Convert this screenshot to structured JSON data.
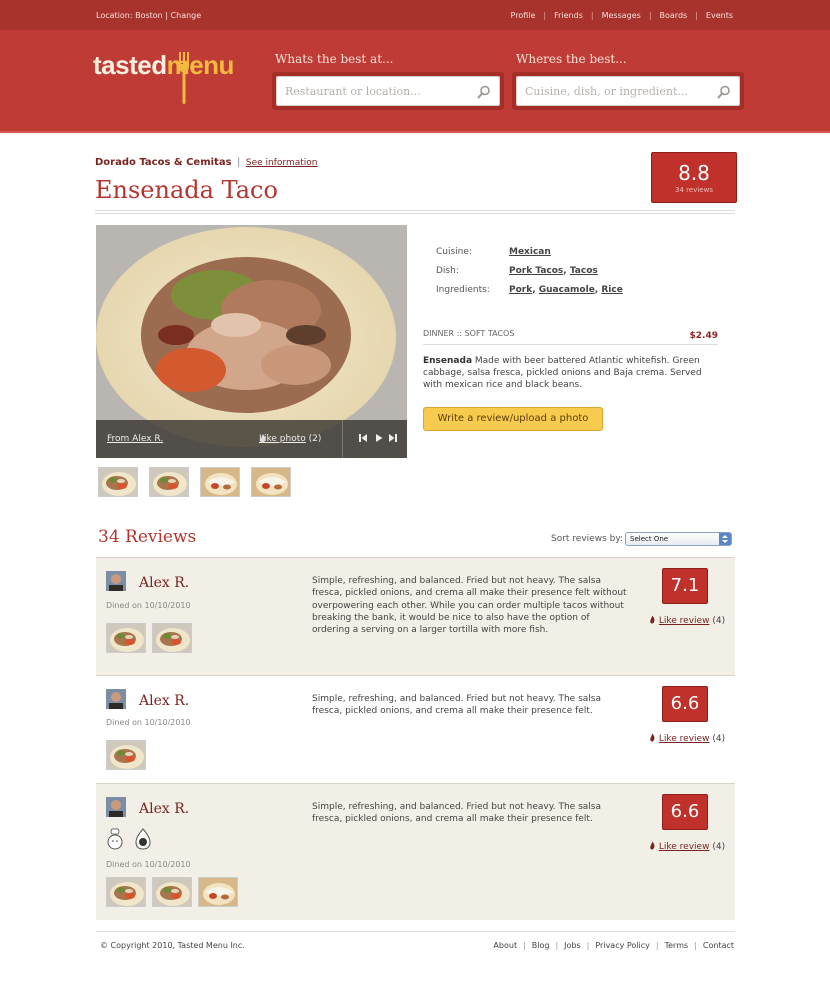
{
  "topbar": {
    "location_label": "Location: Boston",
    "change_label": "Change",
    "nav": [
      "Profile",
      "Friends",
      "Messages",
      "Boards",
      "Events"
    ]
  },
  "header": {
    "logo_main": "tasted",
    "logo_accent": "menu",
    "search_best_label": "Whats the best at...",
    "search_best_placeholder": "Restaurant or location...",
    "search_where_label": "Wheres the best...",
    "search_where_placeholder": "Cuisine, dish, or ingredient..."
  },
  "dish": {
    "restaurant": "Dorado Tacos & Cemitas",
    "see_info": "See information",
    "title": "Ensenada Taco",
    "score": "8.8",
    "review_count_label": "34 reviews"
  },
  "photo": {
    "from": "From Alex R.",
    "like_label": "Like photo",
    "like_count": "(2)"
  },
  "details": {
    "cuisine_label": "Cuisine:",
    "cuisine": "Mexican",
    "dish_label": "Dish:",
    "dish_1": "Pork Tacos",
    "dish_2": "Tacos",
    "ingredients_label": "Ingredients:",
    "ing_1": "Pork",
    "ing_2": "Guacamole",
    "ing_3": "Rice",
    "menu_section": "DINNER :: SOFT TACOS",
    "price": "$2.49",
    "desc_name": "Ensenada",
    "desc_text": " Made with beer battered Atlantic whitefish. Green cabbage, salsa fresca, pickled onions and Baja crema. Served with mexican rice and black beans.",
    "write_button": "Write a review/upload a photo"
  },
  "reviews": {
    "title": "34 Reviews",
    "sort_label": "Sort reviews by:",
    "sort_value": "Select One",
    "items": [
      {
        "name": "Alex R.",
        "dined": "Dined on 10/10/2010",
        "text": "Simple, refreshing, and balanced.  Fried but not heavy. The salsa fresca, pickled onions, and crema all make their presence felt without overpowering each other.  While you can order multiple tacos without breaking the bank, it would be nice to also have the option of ordering a serving on a larger tortilla with more fish.",
        "score": "7.1",
        "like_label": "Like review",
        "like_count": "(4)"
      },
      {
        "name": "Alex R.",
        "dined": "Dined on 10/10/2010",
        "text": "Simple, refreshing, and balanced.  Fried but not heavy. The salsa fresca, pickled onions, and crema all make their presence felt.",
        "score": "6.6",
        "like_label": "Like review",
        "like_count": "(4)"
      },
      {
        "name": "Alex R.",
        "dined": "Dined on 10/10/2010",
        "text": "Simple, refreshing, and balanced.  Fried but not heavy. The salsa fresca, pickled onions, and crema all make their presence felt.",
        "score": "6.6",
        "like_label": "Like review",
        "like_count": "(4)"
      }
    ]
  },
  "footer": {
    "copyright": "© Copyright 2010, Tasted Menu Inc.",
    "links": [
      "About",
      "Blog",
      "Jobs",
      "Privacy Policy",
      "Terms",
      "Contact"
    ]
  },
  "colors": {
    "brand_red": "#bf3b35",
    "topbar_red": "#a8322c",
    "score_red": "#c0312b",
    "button_yellow": "#f7cb4d",
    "logo_yellow": "#f4b93f",
    "review_bg": "#f1efe6"
  },
  "icons": [
    "search-icon",
    "fork-icon",
    "flame-icon",
    "first-icon",
    "play-icon",
    "last-icon",
    "chef-badge-icon",
    "drop-badge-icon"
  ]
}
